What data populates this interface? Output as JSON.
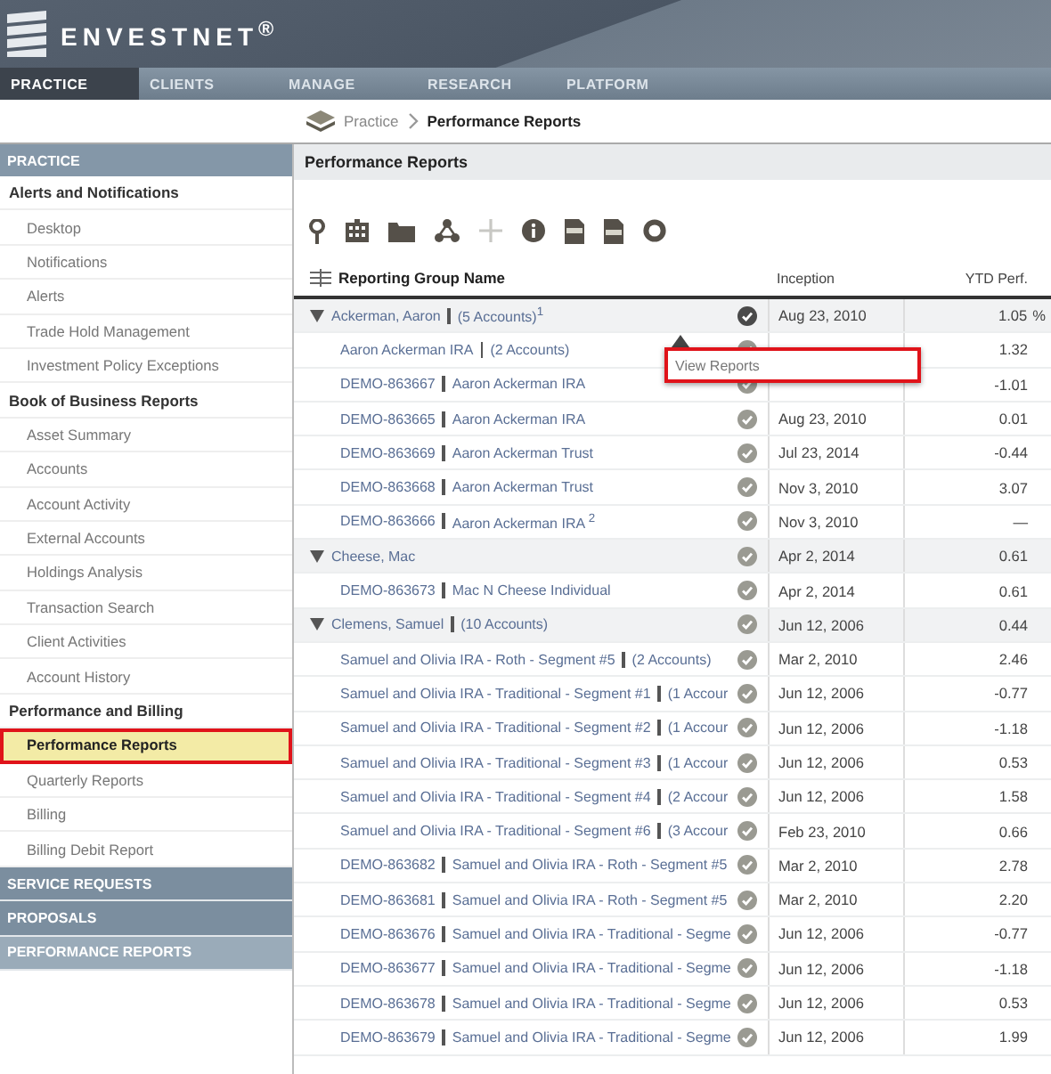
{
  "brand": "ENVESTNET$^{®}$",
  "nav": [
    {
      "label": "PRACTICE",
      "selected": true
    },
    {
      "label": "CLIENTS",
      "selected": false
    },
    {
      "label": "MANAGE",
      "selected": false
    },
    {
      "label": "RESEARCH",
      "selected": false
    },
    {
      "label": "PLATFORM",
      "selected": false
    }
  ],
  "breadcrumb": {
    "parent": "Practice",
    "current": "Performance Reports"
  },
  "sidebar": {
    "title": "PRACTICE",
    "groups": [
      {
        "label": "Alerts and Notifications",
        "items": [
          {
            "label": "Desktop",
            "selected": false
          },
          {
            "label": "Notifications",
            "selected": false
          },
          {
            "label": "Alerts",
            "selected": false
          },
          {
            "label": "Trade Hold Management",
            "selected": false
          },
          {
            "label": "Investment Policy Exceptions",
            "selected": false
          }
        ]
      },
      {
        "label": "Book of Business Reports",
        "items": [
          {
            "label": "Asset Summary",
            "selected": false
          },
          {
            "label": "Accounts",
            "selected": false
          },
          {
            "label": "Account Activity",
            "selected": false
          },
          {
            "label": "External Accounts",
            "selected": false
          },
          {
            "label": "Holdings Analysis",
            "selected": false
          },
          {
            "label": "Transaction Search",
            "selected": false
          },
          {
            "label": "Client Activities",
            "selected": false
          },
          {
            "label": "Account History",
            "selected": false
          }
        ]
      },
      {
        "label": "Performance and Billing",
        "items": [
          {
            "label": "Performance Reports",
            "selected": true
          },
          {
            "label": "Quarterly Reports",
            "selected": false
          },
          {
            "label": "Billing",
            "selected": false
          },
          {
            "label": "Billing Debit Report",
            "selected": false
          }
        ]
      }
    ],
    "panels": [
      {
        "label": "SERVICE REQUESTS",
        "kind": "dark"
      },
      {
        "label": "PROPOSALS",
        "kind": "dark"
      },
      {
        "label": "PERFORMANCE REPORTS",
        "kind": "light"
      }
    ]
  },
  "main": {
    "title": "Performance Reports",
    "toolbar": [
      {
        "kind": "pin",
        "disabled": false
      },
      {
        "kind": "calculator",
        "disabled": false
      },
      {
        "kind": "folder",
        "disabled": false
      },
      {
        "kind": "share",
        "disabled": false
      },
      {
        "kind": "add",
        "disabled": true
      },
      {
        "kind": "info",
        "disabled": false
      },
      {
        "kind": "pdf",
        "disabled": false
      },
      {
        "kind": "csv",
        "disabled": false
      },
      {
        "kind": "ring",
        "disabled": false
      }
    ],
    "columns": [
      "Reporting Group Name",
      "Inception",
      "YTD Perf."
    ],
    "rows": [
      {
        "kind": "group",
        "expanded": true,
        "name": "Ackerman, Aaron",
        "detail": "(5 Accounts)$^{1}$",
        "inception": "Aug 23, 2010",
        "ytd": "1.05",
        "unit": "%",
        "active": true
      },
      {
        "kind": "child",
        "name": "Aaron Ackerman IRA",
        "detail": "(2 Accounts)",
        "ytd": "1.32",
        "active": false
      },
      {
        "kind": "child",
        "name": "DEMO-863667",
        "detail": "Aaron Ackerman IRA",
        "ytd": "-1.01",
        "active": false
      },
      {
        "kind": "child",
        "name": "DEMO-863665",
        "detail": "Aaron Ackerman IRA",
        "inception": "Aug 23, 2010",
        "ytd": "0.01",
        "active": false
      },
      {
        "kind": "child",
        "name": "DEMO-863669",
        "detail": "Aaron Ackerman Trust",
        "inception": "Jul 23, 2014",
        "ytd": "-0.44",
        "active": false
      },
      {
        "kind": "child",
        "name": "DEMO-863668",
        "detail": "Aaron Ackerman Trust",
        "inception": "Nov 3, 2010",
        "ytd": "3.07",
        "active": false
      },
      {
        "kind": "child",
        "name": "DEMO-863666",
        "detail": "Aaron Ackerman IRA $^{2}$",
        "inception": "Nov 3, 2010",
        "ytd": "—",
        "active": false
      },
      {
        "kind": "group",
        "expanded": true,
        "name": "Cheese, Mac",
        "inception": "Apr 2, 2014",
        "ytd": "0.61",
        "active": false
      },
      {
        "kind": "child",
        "name": "DEMO-863673",
        "detail": "Mac N Cheese Individual",
        "inception": "Apr 2, 2014",
        "ytd": "0.61",
        "active": false
      },
      {
        "kind": "group",
        "expanded": true,
        "name": "Clemens, Samuel",
        "detail": "(10 Accounts)",
        "inception": "Jun 12, 2006",
        "ytd": "0.44",
        "active": false
      },
      {
        "kind": "child",
        "name": "Samuel and Olivia IRA - Roth - Segment #5",
        "detail": "(2 Accounts)",
        "inception": "Mar 2, 2010",
        "ytd": "2.46",
        "active": false
      },
      {
        "kind": "child",
        "name": "Samuel and Olivia IRA - Traditional - Segment #1",
        "detail": "(1 Accour",
        "inception": "Jun 12, 2006",
        "ytd": "-0.77",
        "active": false
      },
      {
        "kind": "child",
        "name": "Samuel and Olivia IRA - Traditional - Segment #2",
        "detail": "(1 Accour",
        "inception": "Jun 12, 2006",
        "ytd": "-1.18",
        "active": false
      },
      {
        "kind": "child",
        "name": "Samuel and Olivia IRA - Traditional - Segment #3",
        "detail": "(1 Accour",
        "inception": "Jun 12, 2006",
        "ytd": "0.53",
        "active": false
      },
      {
        "kind": "child",
        "name": "Samuel and Olivia IRA - Traditional - Segment #4",
        "detail": "(2 Accour",
        "inception": "Jun 12, 2006",
        "ytd": "1.58",
        "active": false
      },
      {
        "kind": "child",
        "name": "Samuel and Olivia IRA - Traditional - Segment #6",
        "detail": "(3 Accour",
        "inception": "Feb 23, 2010",
        "ytd": "0.66",
        "active": false
      },
      {
        "kind": "child",
        "name": "DEMO-863682",
        "detail": "Samuel and Olivia IRA - Roth - Segment #5",
        "inception": "Mar 2, 2010",
        "ytd": "2.78",
        "active": false
      },
      {
        "kind": "child",
        "name": "DEMO-863681",
        "detail": "Samuel and Olivia IRA - Roth - Segment #5",
        "inception": "Mar 2, 2010",
        "ytd": "2.20",
        "active": false
      },
      {
        "kind": "child",
        "name": "DEMO-863676",
        "detail": "Samuel and Olivia IRA - Traditional - Segme",
        "inception": "Jun 12, 2006",
        "ytd": "-0.77",
        "active": false
      },
      {
        "kind": "child",
        "name": "DEMO-863677",
        "detail": "Samuel and Olivia IRA - Traditional - Segme",
        "inception": "Jun 12, 2006",
        "ytd": "-1.18",
        "active": false
      },
      {
        "kind": "child",
        "name": "DEMO-863678",
        "detail": "Samuel and Olivia IRA - Traditional - Segme",
        "inception": "Jun 12, 2006",
        "ytd": "0.53",
        "active": false
      },
      {
        "kind": "child",
        "name": "DEMO-863679",
        "detail": "Samuel and Olivia IRA - Traditional - Segme",
        "inception": "Jun 12, 2006",
        "ytd": "1.99",
        "active": false
      }
    ],
    "popup": {
      "label": "View Reports"
    }
  }
}
